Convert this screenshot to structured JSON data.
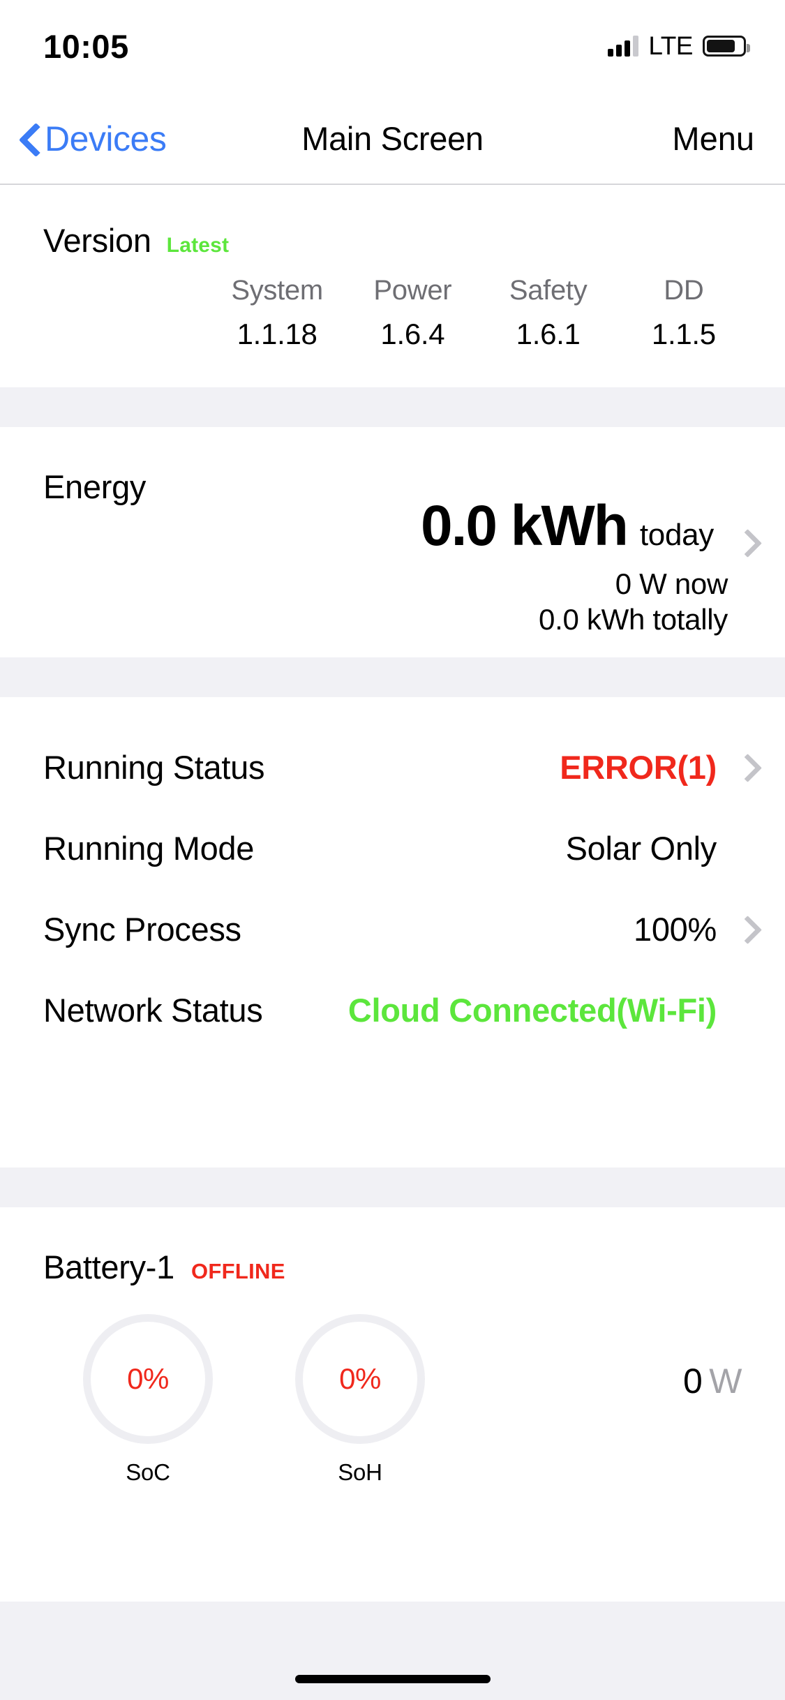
{
  "status_bar": {
    "time": "10:05",
    "network_type": "LTE",
    "signal_icon": "signal-bars-icon",
    "battery_icon": "battery-icon"
  },
  "nav_bar": {
    "back_label": "Devices",
    "back_icon": "chevron-left-icon",
    "title": "Main Screen",
    "menu_label": "Menu"
  },
  "version": {
    "title": "Version",
    "badge": "Latest",
    "columns": [
      {
        "label": "System",
        "value": "1.1.18"
      },
      {
        "label": "Power",
        "value": "1.6.4"
      },
      {
        "label": "Safety",
        "value": "1.6.1"
      },
      {
        "label": "DD",
        "value": "1.1.5"
      }
    ]
  },
  "energy": {
    "title": "Energy",
    "value": "0.0 kWh",
    "value_suffix": "today",
    "now": "0  W now",
    "total": "0.0  kWh totally",
    "chevron_icon": "chevron-right-icon"
  },
  "status_rows": [
    {
      "label": "Running Status",
      "value": "ERROR(1)",
      "style": "error",
      "chevron": true
    },
    {
      "label": "Running Mode",
      "value": "Solar Only",
      "style": "plain",
      "chevron": false
    },
    {
      "label": "Sync Process",
      "value": "100%",
      "style": "plain",
      "chevron": true
    },
    {
      "label": "Network Status",
      "value": "Cloud Connected(Wi-Fi)",
      "style": "green",
      "chevron": false
    }
  ],
  "battery": {
    "title": "Battery-1",
    "badge": "OFFLINE",
    "gauges": [
      {
        "value": "0%",
        "label": "SoC"
      },
      {
        "value": "0%",
        "label": "SoH"
      }
    ],
    "power_value": "0",
    "power_unit": "W"
  },
  "colors": {
    "accent_blue": "#3b7cf6",
    "success_green": "#5ce63c",
    "error_red": "#f0281c",
    "muted_gray": "#6e6e73",
    "section_bg": "#f1f1f5"
  }
}
